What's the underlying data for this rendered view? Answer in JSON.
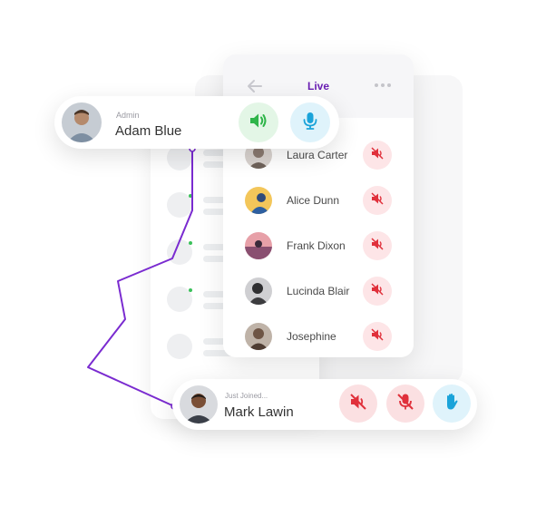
{
  "live_panel": {
    "title": "Live",
    "participants": [
      {
        "name": "Laura Carter",
        "avatar_color": "#8a7a70"
      },
      {
        "name": "Alice Dunn",
        "avatar_color": "#e8b04a"
      },
      {
        "name": "Frank Dixon",
        "avatar_color": "#c0607a"
      },
      {
        "name": "Lucinda Blair",
        "avatar_color": "#4a4a4a"
      },
      {
        "name": "Josephine",
        "avatar_color": "#7a6050"
      }
    ]
  },
  "admin_card": {
    "role": "Admin",
    "name": "Adam Blue"
  },
  "join_card": {
    "subtitle": "Just Joined...",
    "name": "Mark Lawin"
  },
  "colors": {
    "accent_purple": "#6a1fb3",
    "speaker_green": "#2fb54a",
    "mic_blue": "#1aa3d9",
    "mute_red": "#e0303b"
  }
}
